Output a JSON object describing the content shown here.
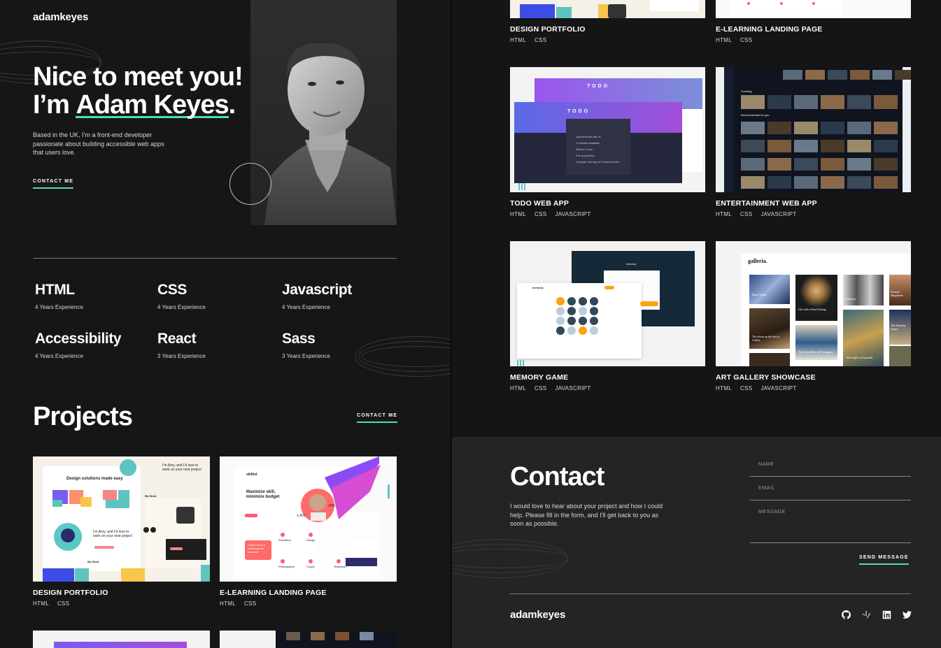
{
  "header": {
    "logo": "adamkeyes"
  },
  "social": [
    {
      "icon": "github-icon"
    },
    {
      "icon": "frontend-mentor-icon"
    },
    {
      "icon": "linkedin-icon"
    },
    {
      "icon": "twitter-icon"
    }
  ],
  "hero": {
    "greeting_line1": "Nice to meet you!",
    "greeting_line2_prefix": "I’m ",
    "greeting_name": "Adam Keyes",
    "greeting_suffix": ".",
    "bio": "Based in the UK, I’m a front-end developer passionate about building accessible web apps that users love.",
    "cta": "CONTACT ME"
  },
  "skills": [
    {
      "name": "HTML",
      "exp": "4 Years Experience"
    },
    {
      "name": "CSS",
      "exp": "4 Years Experience"
    },
    {
      "name": "Javascript",
      "exp": "4 Years Experience"
    },
    {
      "name": "Accessibility",
      "exp": "4 Years Experience"
    },
    {
      "name": "React",
      "exp": "3 Years Experience"
    },
    {
      "name": "Sass",
      "exp": "3 Years Experience"
    }
  ],
  "projects_section": {
    "title": "Projects",
    "cta": "CONTACT ME"
  },
  "projects_left": [
    {
      "title": "DESIGN PORTFOLIO",
      "tags": [
        "HTML",
        "CSS"
      ]
    },
    {
      "title": "E-LEARNING LANDING PAGE",
      "tags": [
        "HTML",
        "CSS"
      ]
    }
  ],
  "projects_right": [
    {
      "title": "DESIGN PORTFOLIO",
      "tags": [
        "HTML",
        "CSS"
      ]
    },
    {
      "title": "E-LEARNING LANDING PAGE",
      "tags": [
        "HTML",
        "CSS"
      ]
    },
    {
      "title": "TODO WEB APP",
      "tags": [
        "HTML",
        "CSS",
        "JAVASCRIPT"
      ]
    },
    {
      "title": "ENTERTAINMENT WEB APP",
      "tags": [
        "HTML",
        "CSS",
        "JAVASCRIPT"
      ]
    },
    {
      "title": "MEMORY GAME",
      "tags": [
        "HTML",
        "CSS",
        "JAVASCRIPT"
      ]
    },
    {
      "title": "ART GALLERY SHOWCASE",
      "tags": [
        "HTML",
        "CSS",
        "JAVASCRIPT"
      ]
    }
  ],
  "thumbs": {
    "dp_heading": "Design solutions made easy",
    "dp_intro": "I’m Amy, and I’d love to work on your next project",
    "dp_work": "My Work",
    "el_brand": "skilled",
    "el_heading": "Maximize skill, minimize budget",
    "el_stat": "1,401",
    "el_pct": "29%",
    "el_callout": "Check out our most popular courses!",
    "el_cards": [
      "Animation",
      "Design",
      "Photography",
      "Crypto",
      "Business"
    ],
    "todo_label": "TODO",
    "todo_items": [
      "Jog around the park 3x",
      "10 minutes meditation",
      "Read for 1 hour",
      "Pick up groceries",
      "Complete Todo App on Frontend Mentor"
    ],
    "ent_trending": "Trending",
    "ent_recommended": "Recommended for you",
    "mem_title": "memory",
    "art_brand": "galleria.",
    "art_captions": [
      "Starry Night",
      "Girl with a Pearl Earring",
      "Guernica",
      "Penitent Magdalene",
      "The Storm on the Sea of Galilee",
      "The Great Wave off Kanagawa",
      "Van Gogh's self-portrait",
      "The Sleeping Gypsy"
    ]
  },
  "contact": {
    "title": "Contact",
    "text": "I would love to hear about your project and how I could help. Please fill in the form, and I’ll get back to you as soon as possible.",
    "name_placeholder": "NAME",
    "email_placeholder": "EMAIL",
    "message_placeholder": "MESSAGE",
    "send": "SEND MESSAGE"
  },
  "footer": {
    "logo": "adamkeyes"
  },
  "colors": {
    "accent": "#4ee1a0",
    "bg": "#151515",
    "contact_bg": "#242424"
  }
}
